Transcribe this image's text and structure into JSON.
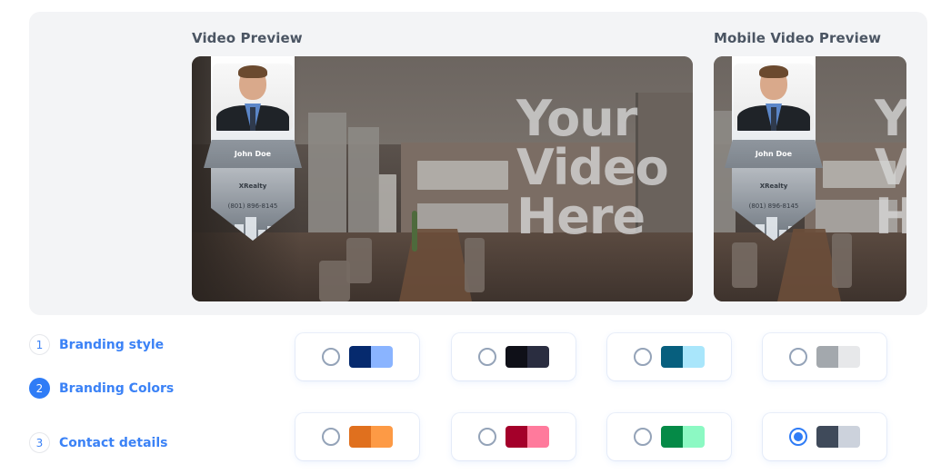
{
  "preview": {
    "video_title": "Video Preview",
    "mobile_title": "Mobile Video Preview",
    "overlay_text": "Your\nVideo\nHere",
    "mobile_overlay_text": "Y\nV\nH",
    "agent": {
      "name": "John Doe",
      "company": "XRealty",
      "phone": "(801) 896-8145"
    }
  },
  "steps": [
    {
      "number": "1",
      "label": "Branding style",
      "active": false
    },
    {
      "number": "2",
      "label": "Branding Colors",
      "active": true
    },
    {
      "number": "3",
      "label": "Contact details",
      "active": false
    }
  ],
  "color_options": [
    {
      "id": "navy-blue",
      "primary": "#062a6e",
      "secondary": "#8ab4ff",
      "selected": false
    },
    {
      "id": "black-slate",
      "primary": "#0f1018",
      "secondary": "#2a2d40",
      "selected": false
    },
    {
      "id": "teal-cyan",
      "primary": "#075f7e",
      "secondary": "#a9e6fb",
      "selected": false
    },
    {
      "id": "gray-light",
      "primary": "#a3a8ad",
      "secondary": "#e7e8ea",
      "selected": false
    },
    {
      "id": "orange",
      "primary": "#e0701e",
      "secondary": "#fd9a45",
      "selected": false
    },
    {
      "id": "crimson-pink",
      "primary": "#a4002a",
      "secondary": "#ff7a9c",
      "selected": false
    },
    {
      "id": "green-mint",
      "primary": "#058a47",
      "secondary": "#8cf9c3",
      "selected": false
    },
    {
      "id": "slate-gray",
      "primary": "#3f4a5a",
      "secondary": "#ccd2dc",
      "selected": true
    }
  ],
  "colors": {
    "accent": "#2f7cf6",
    "panel_bg": "#f3f4f6",
    "title_text": "#4b5563"
  }
}
